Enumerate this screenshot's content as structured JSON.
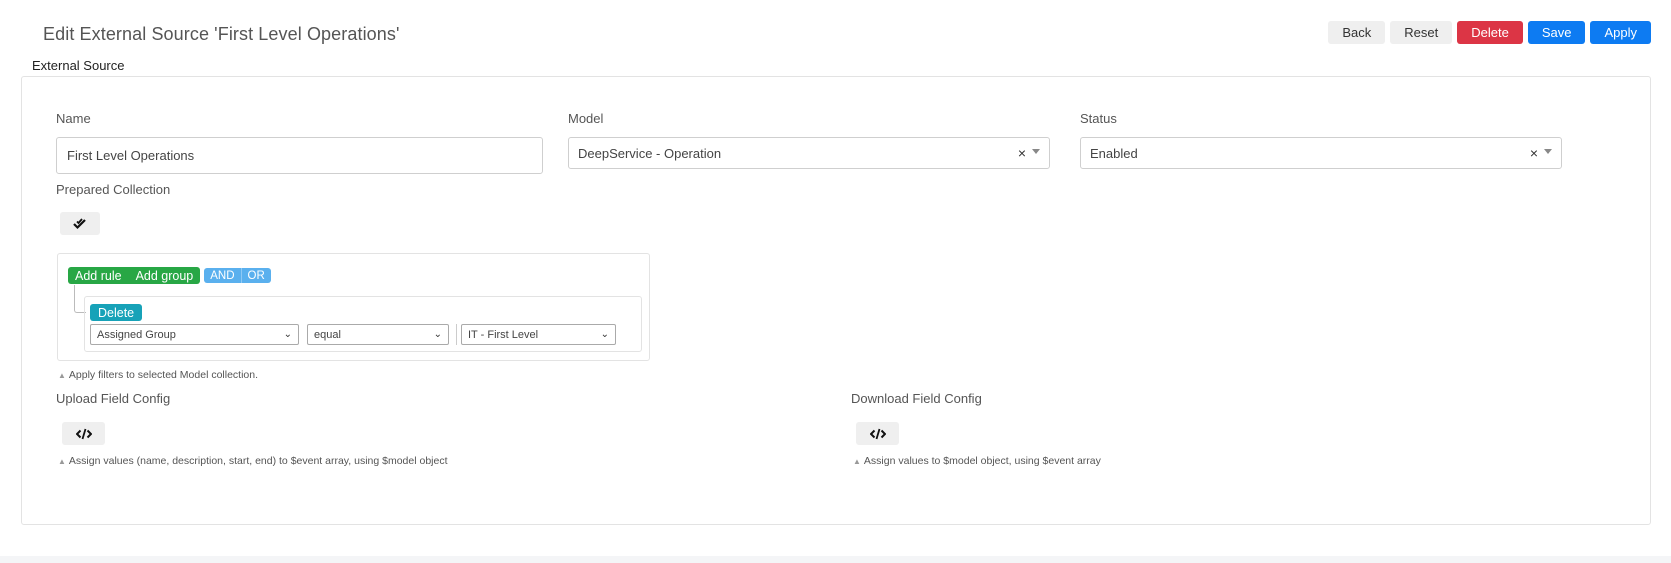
{
  "header": {
    "title": "Edit External Source 'First Level Operations'",
    "buttons": {
      "back": "Back",
      "reset": "Reset",
      "delete": "Delete",
      "save": "Save",
      "apply": "Apply"
    }
  },
  "section": {
    "label": "External Source"
  },
  "form": {
    "name": {
      "label": "Name",
      "value": "First Level Operations"
    },
    "model": {
      "label": "Model",
      "value": "DeepService - Operation"
    },
    "status": {
      "label": "Status",
      "value": "Enabled"
    },
    "prepared_collection": {
      "label": "Prepared Collection",
      "help": "Apply filters to selected Model collection."
    },
    "query_builder": {
      "add_rule": "Add rule",
      "add_group": "Add group",
      "and": "AND",
      "or": "OR",
      "rule": {
        "delete": "Delete",
        "field": "Assigned Group",
        "operator": "equal",
        "value": "IT - First Level"
      }
    },
    "upload_field_config": {
      "label": "Upload Field Config",
      "help": "Assign values (name, description, start, end) to $event array, using $model object"
    },
    "download_field_config": {
      "label": "Download Field Config",
      "help": "Assign values to $model object, using $event array"
    }
  },
  "icons": {
    "clear": "×",
    "check": "double-check-icon",
    "code": "code-icon",
    "help": "▲"
  },
  "colors": {
    "primary": "#0d7bf2",
    "danger": "#dc3545",
    "success": "#28a745",
    "info": "#17a2b8",
    "condition": "#5ab0ee"
  }
}
